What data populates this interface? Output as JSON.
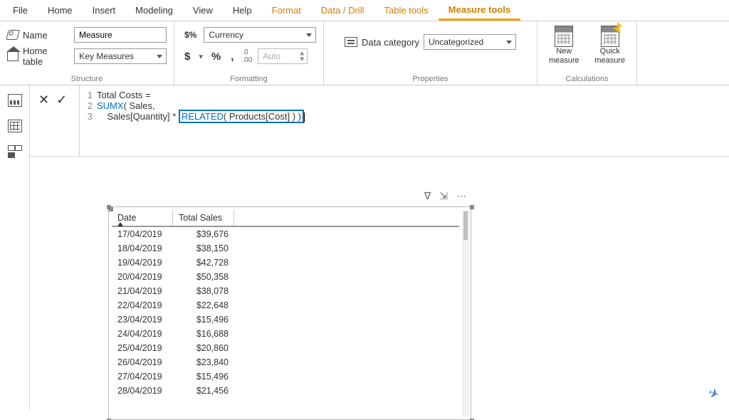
{
  "menu": {
    "file": "File",
    "home": "Home",
    "insert": "Insert",
    "modeling": "Modeling",
    "view": "View",
    "help": "Help",
    "format": "Format",
    "datadrill": "Data / Drill",
    "tabletools": "Table tools",
    "measuretools": "Measure tools"
  },
  "structure": {
    "name_lbl": "Name",
    "name_val": "Measure",
    "home_lbl": "Home table",
    "home_val": "Key Measures",
    "group": "Structure"
  },
  "formatting": {
    "sym": "$%",
    "fmt_val": "Currency",
    "dollar": "$",
    "pct": "%",
    "comma": ",",
    "dec": ".00→.0",
    "auto": "Auto",
    "group": "Formatting"
  },
  "properties": {
    "cat_lbl": "Data category",
    "cat_val": "Uncategorized",
    "group": "Properties"
  },
  "calculations": {
    "new1": "New",
    "new2": "measure",
    "quick1": "Quick",
    "quick2": "measure",
    "group": "Calculations"
  },
  "formula": {
    "x": "✕",
    "chk": "✓",
    "l1_num": "1",
    "l1": "Total Costs =",
    "l2_num": "2",
    "l2_a": "SUMX",
    "l2_b": "( Sales,",
    "l3_num": "3",
    "l3_pre": "    Sales[Quantity] * ",
    "l3_hl_a": "RELATED",
    "l3_hl_b": "( Products[Cost] ) )"
  },
  "vis": {
    "filter": "∇",
    "focus": "⇲",
    "more": "⋯",
    "col0": "Date",
    "col1": "Total Sales",
    "rows": [
      {
        "d": "17/04/2019",
        "v": "$39,676"
      },
      {
        "d": "18/04/2019",
        "v": "$38,150"
      },
      {
        "d": "19/04/2019",
        "v": "$42,728"
      },
      {
        "d": "20/04/2019",
        "v": "$50,358"
      },
      {
        "d": "21/04/2019",
        "v": "$38,078"
      },
      {
        "d": "22/04/2019",
        "v": "$22,648"
      },
      {
        "d": "23/04/2019",
        "v": "$15,496"
      },
      {
        "d": "24/04/2019",
        "v": "$16,688"
      },
      {
        "d": "25/04/2019",
        "v": "$20,860"
      },
      {
        "d": "26/04/2019",
        "v": "$23,840"
      },
      {
        "d": "27/04/2019",
        "v": "$15,496"
      },
      {
        "d": "28/04/2019",
        "v": "$21,456"
      }
    ]
  },
  "sub": "✈"
}
